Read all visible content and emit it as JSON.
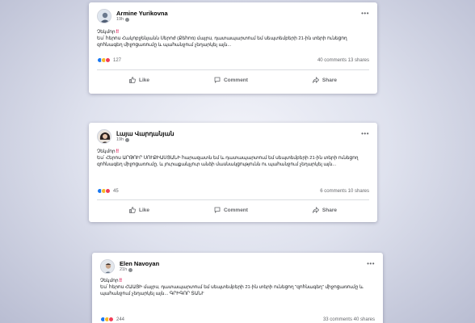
{
  "posts": [
    {
      "author": "Armine Yurikovna",
      "time": "19h",
      "headline": "Չեկմոր",
      "text": "Ես՝ հերոս Հակոբջենյանն Սերոժ (Քեհոռ) մայրս, դատապարտում եմ սեպտեմբերի 21-ին տերի ունեցող զոհնագեղ միջոցառումը և պահանջում չեղարկել այն...",
      "reactions_count": "127",
      "comments": "40 comments",
      "shares": "13 shares"
    },
    {
      "author": "Լայա Վարդանյան",
      "time": "19h",
      "headline": "Չեկմոր",
      "text": "Ես՝ Հերոս ԱՐԹՈՒՐ ՍՈՒՔԻԱՍՅԱՆԻ հարազատն եմ և դատապարտում եմ սեպտեմբերի 21-ին տերի ունեցող զոհնագեղ միջոցառումը, և յուրաքանչյուր անձի մասնակցությունն ու պահանջում չեղարկել այն...",
      "reactions_count": "45",
      "comments": "6 comments",
      "shares": "10 shares"
    },
    {
      "author": "Elen Navoyan",
      "time": "21h",
      "headline": "Չեկմոր",
      "text": "Ես՝ հերոս ՀԱԱՅԻ մայրս, դատապարտում եմ սեպտեմբերի 21-ին տերի ունեցող \"զոհնագեղ\" միջոցառումը և պահանջում չեղարկել այն... ԳՐԻԳՈՐ ՏԱՆՒ",
      "reactions_count": "244",
      "comments": "33 comments",
      "shares": "40 shares"
    }
  ],
  "actions": {
    "like": "Like",
    "comment": "Comment",
    "share": "Share"
  },
  "colors": {
    "link_blue": "#1877f2",
    "headline_bang": "#e0245e"
  }
}
